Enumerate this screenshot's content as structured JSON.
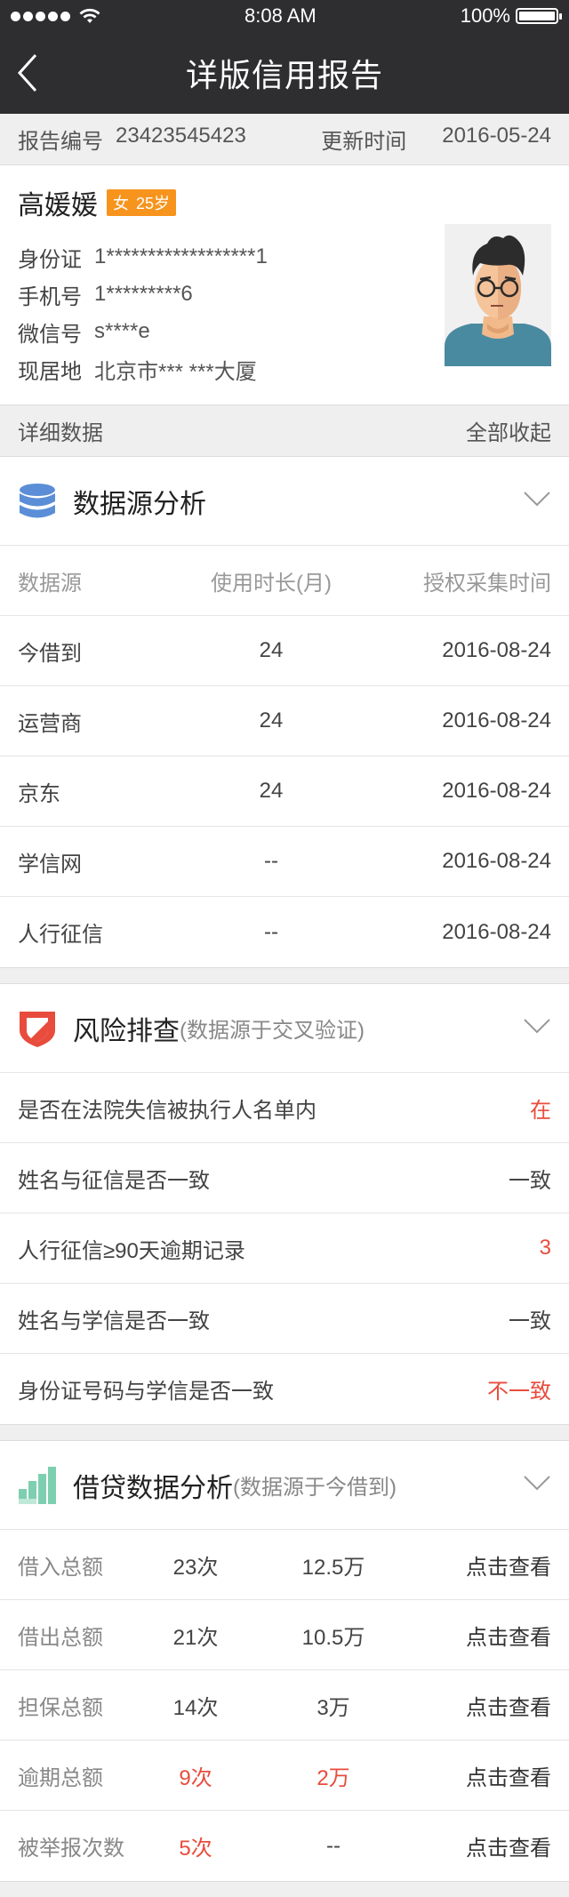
{
  "status": {
    "time": "8:08 AM",
    "battery": "100%",
    "battery_level": 1.0
  },
  "nav": {
    "title": "详版信用报告"
  },
  "meta": {
    "report_label": "报告编号",
    "report_no": "23423545423",
    "update_label": "更新时间",
    "update_date": "2016-05-24"
  },
  "profile": {
    "name": "高媛媛",
    "gender": "女",
    "age": "25岁",
    "info": [
      {
        "label": "身份证",
        "value": "1******************1"
      },
      {
        "label": "手机号",
        "value": "1*********6"
      },
      {
        "label": "微信号",
        "value": "s****e"
      },
      {
        "label": "现居地",
        "value": "北京市*** ***大厦"
      }
    ]
  },
  "detail_bar": {
    "label": "详细数据",
    "collapse": "全部收起"
  },
  "data_source": {
    "title": "数据源分析",
    "headers": [
      "数据源",
      "使用时长(月)",
      "授权采集时间"
    ],
    "rows": [
      {
        "source": "今借到",
        "months": "24",
        "date": "2016-08-24"
      },
      {
        "source": "运营商",
        "months": "24",
        "date": "2016-08-24"
      },
      {
        "source": "京东",
        "months": "24",
        "date": "2016-08-24"
      },
      {
        "source": "学信网",
        "months": "--",
        "date": "2016-08-24"
      },
      {
        "source": "人行征信",
        "months": "--",
        "date": "2016-08-24"
      }
    ]
  },
  "risk": {
    "title": "风险排查",
    "subtitle": "(数据源于交叉验证)",
    "rows": [
      {
        "label": "是否在法院失信被执行人名单内",
        "value": "在",
        "alert": true
      },
      {
        "label": "姓名与征信是否一致",
        "value": "一致",
        "alert": false
      },
      {
        "label": "人行征信≥90天逾期记录",
        "value": "3",
        "alert": true
      },
      {
        "label": "姓名与学信是否一致",
        "value": "一致",
        "alert": false
      },
      {
        "label": "身份证号码与学信是否一致",
        "value": "不一致",
        "alert": true
      }
    ]
  },
  "loan": {
    "title": "借贷数据分析",
    "subtitle": "(数据源于今借到)",
    "rows": [
      {
        "label": "借入总额",
        "count": "23次",
        "amount": "12.5万",
        "action": "点击查看",
        "alert": false
      },
      {
        "label": "借出总额",
        "count": "21次",
        "amount": "10.5万",
        "action": "点击查看",
        "alert": false
      },
      {
        "label": "担保总额",
        "count": "14次",
        "amount": "3万",
        "action": "点击查看",
        "alert": false
      },
      {
        "label": "逾期总额",
        "count": "9次",
        "amount": "2万",
        "action": "点击查看",
        "alert": true
      },
      {
        "label": "被举报次数",
        "count": "5次",
        "amount": "--",
        "action": "点击查看",
        "alert": "count"
      }
    ]
  },
  "colors": {
    "nav_bg": "#2e2e31",
    "accent_red": "#e84c3d",
    "badge": "#f7941d",
    "icon_blue": "#5b8ed6",
    "icon_green": "#7ecfb0"
  }
}
